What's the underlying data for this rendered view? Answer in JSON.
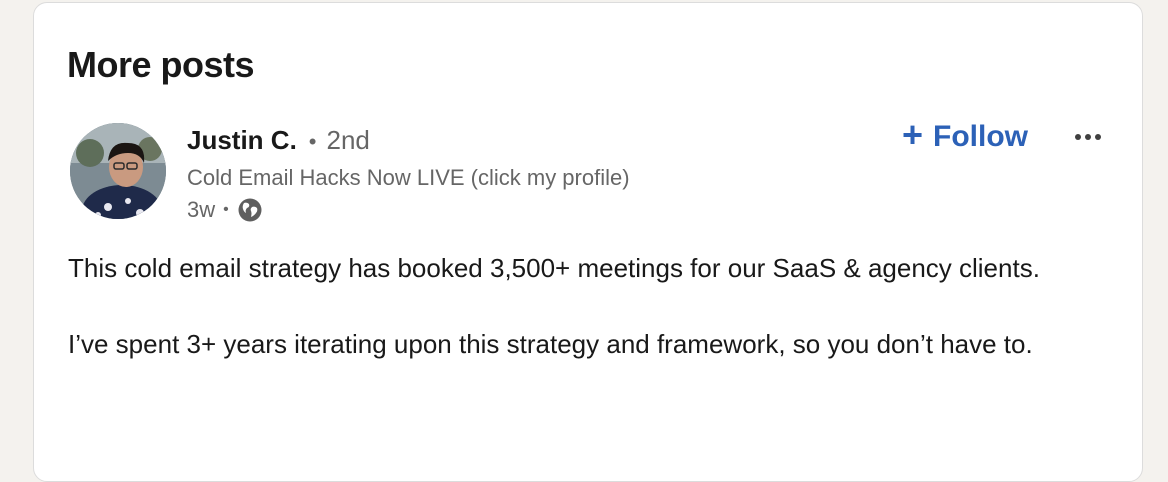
{
  "section": {
    "title": "More posts"
  },
  "post": {
    "author": {
      "name": "Justin C.",
      "separator": "•",
      "degree": "2nd",
      "headline": "Cold Email Hacks Now LIVE (click my profile)"
    },
    "meta": {
      "age": "3w",
      "separator": "•",
      "visibility_icon": "globe-icon"
    },
    "actions": {
      "follow_plus": "+",
      "follow_label": "Follow",
      "more_icon": "ellipsis-icon"
    },
    "body": {
      "paragraph_1": "This cold email strategy has booked 3,500+ meetings for our SaaS & agency clients.",
      "paragraph_2": "I’ve spent 3+ years iterating upon this strategy and framework, so you don’t have to."
    }
  },
  "colors": {
    "page_background": "#f4f2ee",
    "card_background": "#ffffff",
    "primary_text": "#191919",
    "secondary_text": "#666666",
    "accent_blue": "#2c61b7"
  }
}
